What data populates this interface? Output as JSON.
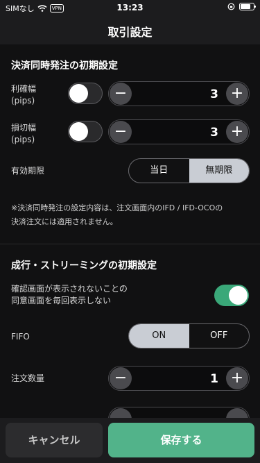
{
  "status_bar": {
    "carrier": "SIMなし",
    "vpn": "VPN",
    "time": "13:23"
  },
  "nav": {
    "title": "取引設定"
  },
  "settlement": {
    "title": "決済同時発注の初期設定",
    "take_profit": {
      "label_line1": "利確幅",
      "label_line2": "(pips)",
      "enabled": false,
      "value": "3",
      "minus": "−",
      "plus": "+"
    },
    "stop_loss": {
      "label_line1": "損切幅",
      "label_line2": "(pips)",
      "enabled": false,
      "value": "3",
      "minus": "−",
      "plus": "+"
    },
    "expiry": {
      "label": "有効期限",
      "options": [
        "当日",
        "無期限"
      ],
      "selected": "無期限"
    },
    "note_line1": "※決済同時発注の設定内容は、注文画面内のIFD / IFD-OCOの",
    "note_line2": "決済注文には適用されません。"
  },
  "market": {
    "title": "成行・ストリーミングの初期設定",
    "confirm": {
      "label_line1": "確認画面が表示されないことの",
      "label_line2": "同意画面を毎回表示しない",
      "enabled": true
    },
    "fifo": {
      "label": "FIFO",
      "options": [
        "ON",
        "OFF"
      ],
      "selected": "ON"
    },
    "quantity": {
      "label": "注文数量",
      "value": "1",
      "minus": "−",
      "plus": "+"
    }
  },
  "footer": {
    "cancel_label": "キャンセル",
    "save_label": "保存する"
  },
  "colors": {
    "accent": "#52b38a",
    "toggle_on": "#3aa879",
    "segment_active": "#c9cdd4"
  }
}
